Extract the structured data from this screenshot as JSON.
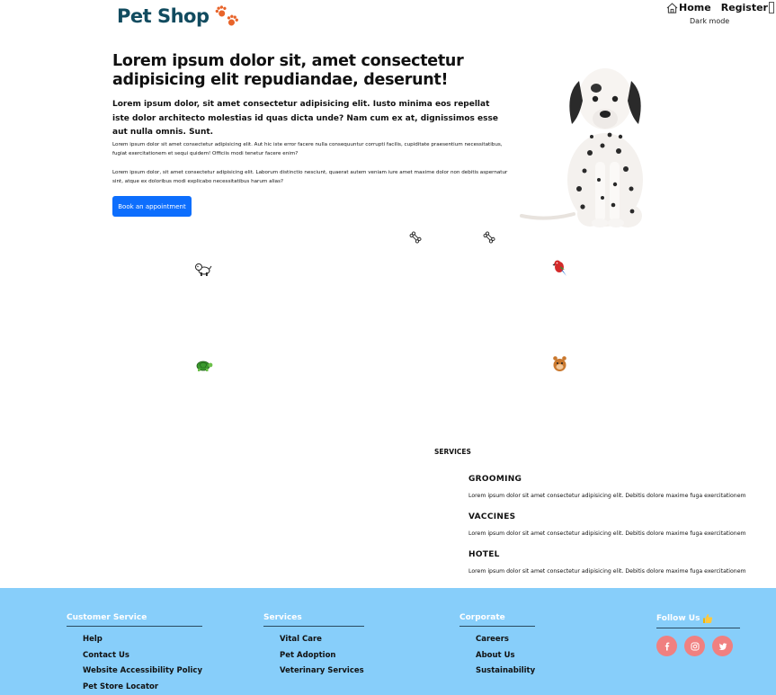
{
  "brand": {
    "name": "Pet Shop",
    "logo_icon": "paw-prints-icon"
  },
  "nav": {
    "home": "Home",
    "register": "Register",
    "dark_mode": "Dark mode"
  },
  "hero": {
    "title": "Lorem ipsum dolor sit, amet consectetur adipisicing elit repudiandae, deserunt!",
    "lead": "Lorem ipsum dolor, sit amet consectetur adipisicing elit. Iusto minima eos repellat iste dolor architecto molestias id quas dicta unde? Nam cum ex at, dignissimos esse aut nulla omnis. Sunt.",
    "paragraph1": "Lorem ipsum dolor sit amet consectetur adipisicing elit. Aut hic iste error facere nulla consequuntur corrupti facilis, cupiditate praesentium necessitatibus, fugiat exercitationem et sequi quidem! Officiis modi tenetur facere enim?",
    "paragraph2": "Lorem ipsum dolor, sit amet consectetur adipisicing elit. Laborum distinctio nesciunt, quaerat autem veniam iure amet maxime dolor non debitis aspernatur sint, atque ex doloribus modi explicabo necessitatibus harum alias?",
    "button": "Book an appointment",
    "image": "dalmatian-puppy"
  },
  "decorations": [
    "bone-icon",
    "bone-icon",
    "dog-icon",
    "parrot-icon",
    "turtle-icon",
    "hamster-icon"
  ],
  "services": {
    "title": "SERVICES",
    "items": [
      {
        "name": "GROOMING",
        "desc": "Lorem ipsum dolor sit amet consectetur adipisicing elit. Debitis dolore maxime fuga exercitationem"
      },
      {
        "name": "VACCINES",
        "desc": "Lorem ipsum dolor sit amet consectetur adipisicing elit. Debitis dolore maxime fuga exercitationem"
      },
      {
        "name": "HOTEL",
        "desc": "Lorem ipsum dolor sit amet consectetur adipisicing elit. Debitis dolore maxime fuga exercitationem"
      }
    ]
  },
  "footer": {
    "customer_service": {
      "title": "Customer Service",
      "links": [
        "Help",
        "Contact Us",
        "Website Accessibility Policy",
        "Pet Store Locator"
      ]
    },
    "services": {
      "title": "Services",
      "links": [
        "Vital Care",
        "Pet Adoption",
        "Veterinary Services"
      ]
    },
    "corporate": {
      "title": "Corporate",
      "links": [
        "Careers",
        "About Us",
        "Sustainability"
      ]
    },
    "follow": {
      "title": "Follow Us",
      "icon": "thumbs-up-icon",
      "socials": [
        "facebook-icon",
        "instagram-icon",
        "twitter-icon"
      ]
    }
  },
  "colors": {
    "footer_bg": "#87cefa",
    "button_bg": "#0d6efd",
    "social_bg": "#f08080",
    "brand": "#114b5f",
    "paws": "#e8642a"
  }
}
